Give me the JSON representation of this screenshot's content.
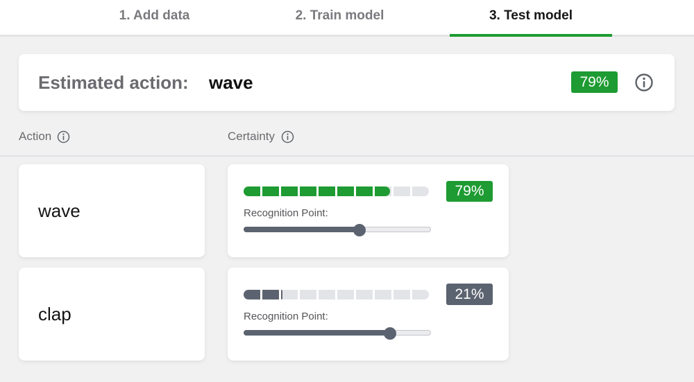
{
  "tabs": [
    {
      "label": "1. Add data",
      "active": false
    },
    {
      "label": "2. Train model",
      "active": false
    },
    {
      "label": "3. Test model",
      "active": true
    }
  ],
  "estimate": {
    "label": "Estimated action:",
    "value": "wave",
    "certainty": "79%",
    "info_icon": "info-icon"
  },
  "columns": {
    "action": "Action",
    "certainty": "Certainty",
    "info_icon": "info-icon"
  },
  "actions": [
    {
      "name": "wave",
      "certainty": 0.79,
      "certainty_label": "79%",
      "color": "#1e9b32",
      "recognition_label": "Recognition Point:",
      "recognition_point": 0.62
    },
    {
      "name": "clap",
      "certainty": 0.21,
      "certainty_label": "21%",
      "color": "#5c6370",
      "recognition_label": "Recognition Point:",
      "recognition_point": 0.78
    }
  ],
  "colors": {
    "accent": "#1e9b32",
    "neutral": "#5c6370",
    "segment_empty": "#e3e4e8",
    "background": "#f1f1f2"
  },
  "segments": 10
}
